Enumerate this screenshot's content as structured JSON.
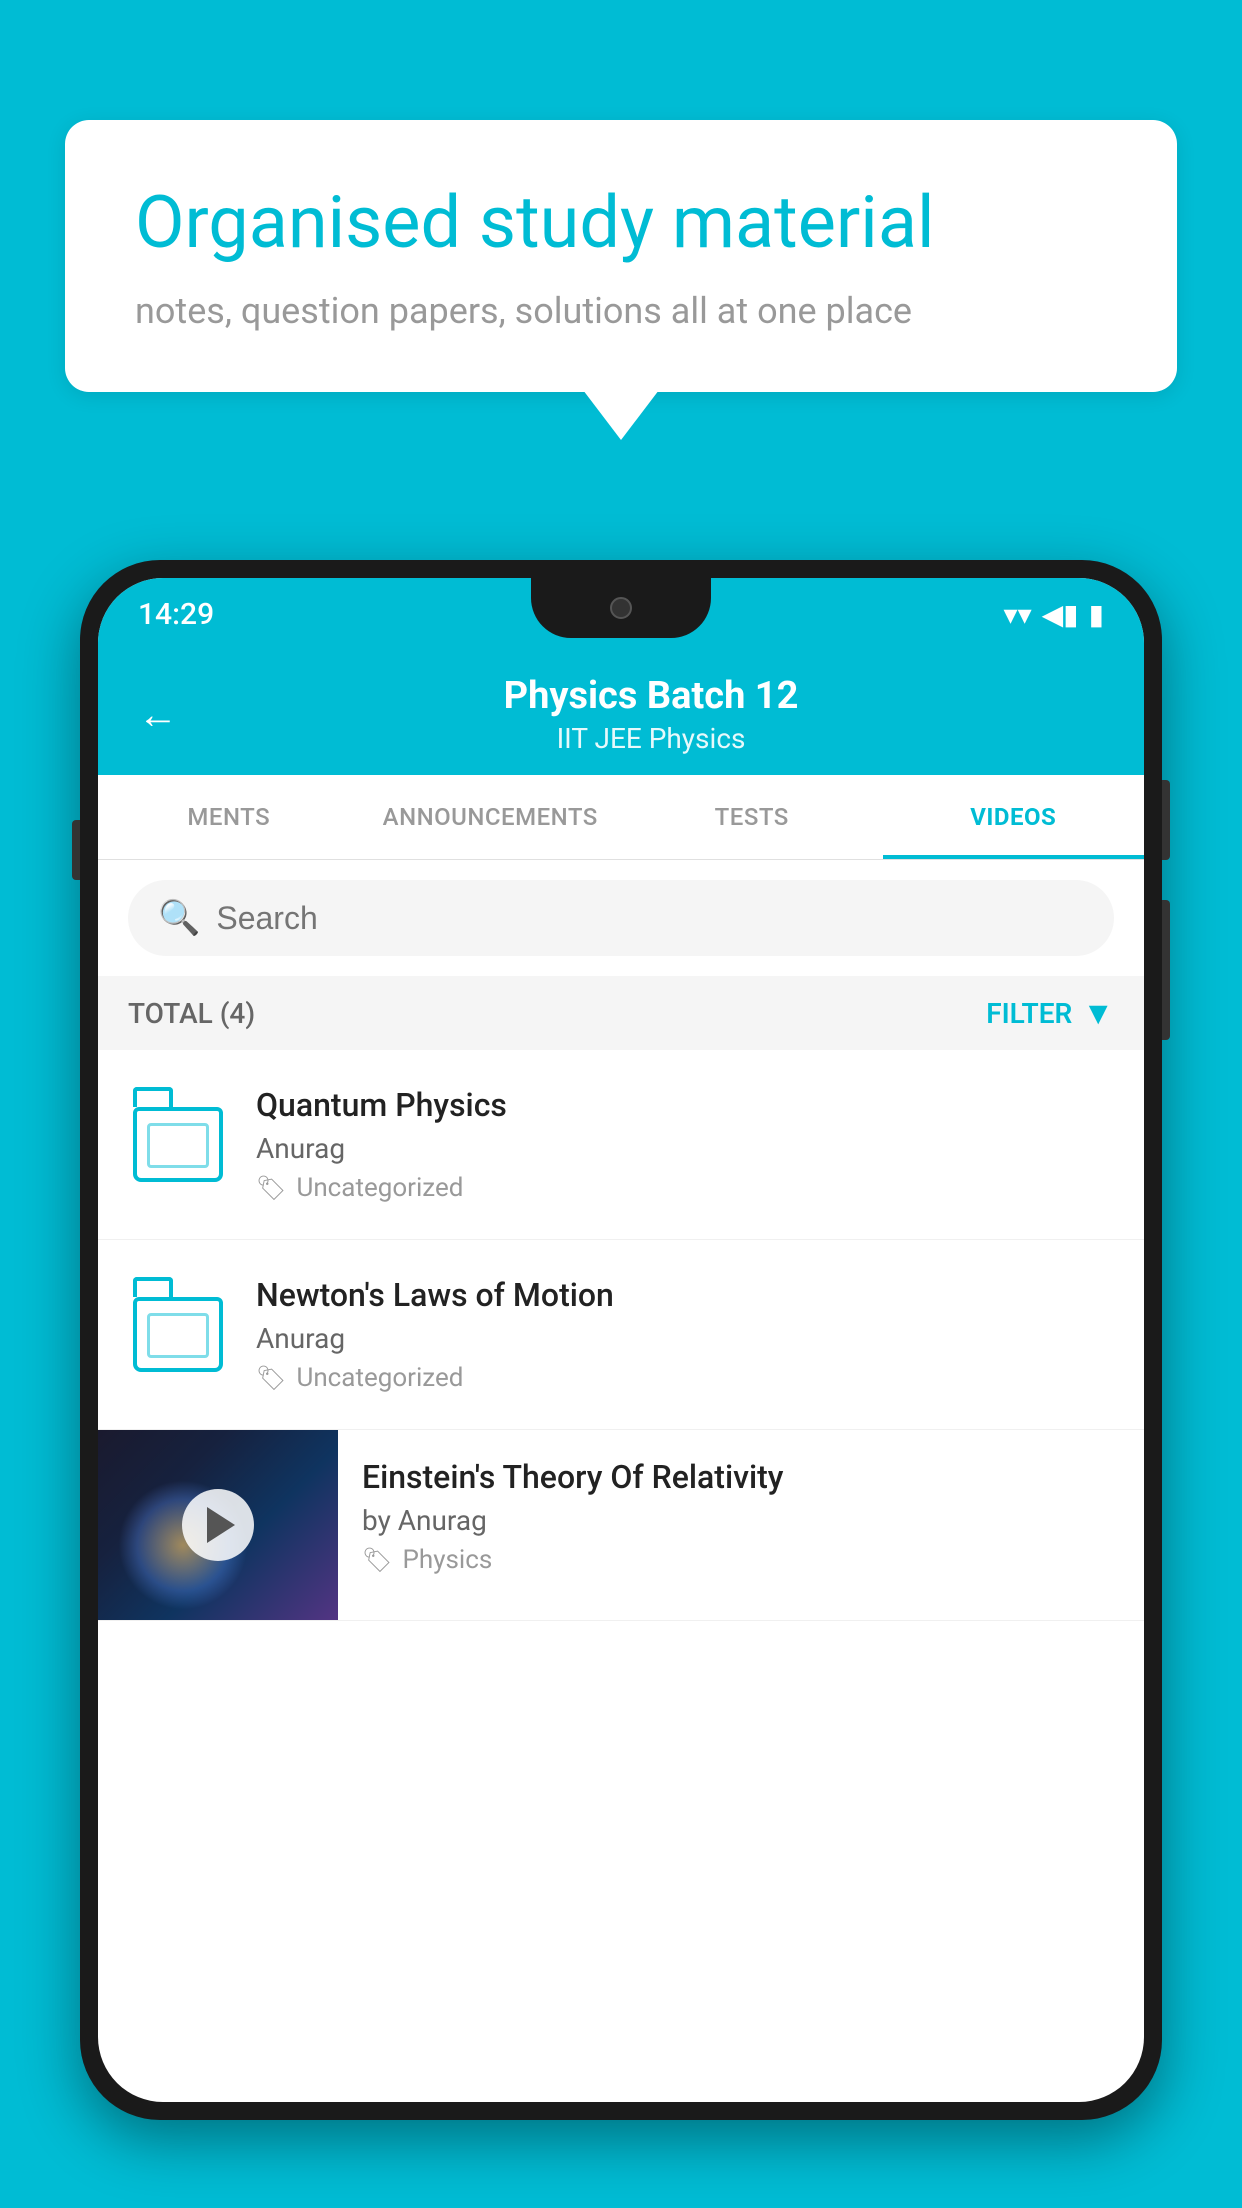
{
  "hero": {
    "title": "Organised study material",
    "subtitle": "notes, question papers, solutions all at one place"
  },
  "status_bar": {
    "time": "14:29",
    "wifi": "▾",
    "signal": "▲",
    "battery": "▮"
  },
  "app_header": {
    "back_label": "←",
    "title": "Physics Batch 12",
    "subtitle": "IIT JEE   Physics"
  },
  "tabs": [
    {
      "label": "MENTS",
      "active": false
    },
    {
      "label": "ANNOUNCEMENTS",
      "active": false
    },
    {
      "label": "TESTS",
      "active": false
    },
    {
      "label": "VIDEOS",
      "active": true
    }
  ],
  "search": {
    "placeholder": "Search"
  },
  "filter_bar": {
    "total_label": "TOTAL (4)",
    "filter_label": "FILTER"
  },
  "videos": [
    {
      "title": "Quantum Physics",
      "author": "Anurag",
      "tag": "Uncategorized",
      "has_thumbnail": false
    },
    {
      "title": "Newton's Laws of Motion",
      "author": "Anurag",
      "tag": "Uncategorized",
      "has_thumbnail": false
    },
    {
      "title": "Einstein's Theory Of Relativity",
      "author": "by Anurag",
      "tag": "Physics",
      "has_thumbnail": true
    }
  ]
}
